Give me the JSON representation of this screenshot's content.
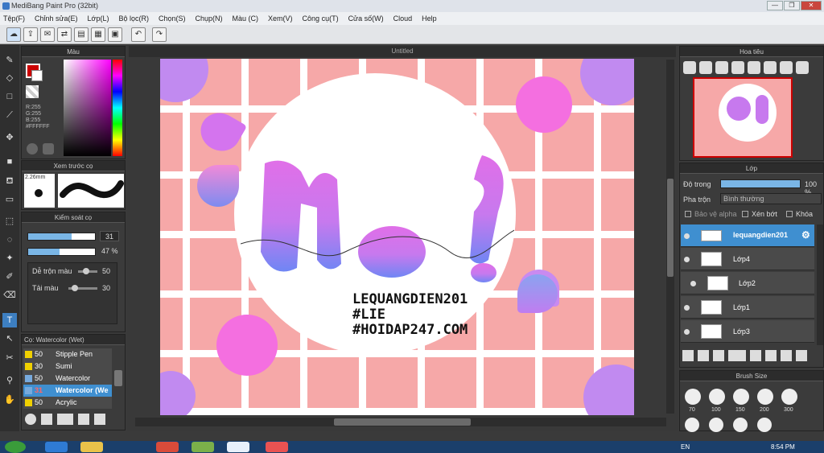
{
  "window": {
    "title": "MediBang Paint Pro (32bit)"
  },
  "menu": [
    "Tệp(F)",
    "Chỉnh sửa(E)",
    "Lớp(L)",
    "Bộ lọc(R)",
    "Chọn(S)",
    "Chụp(N)",
    "Màu (C)",
    "Xem(V)",
    "Công cụ(T)",
    "Cửa số(W)",
    "Cloud",
    "Help"
  ],
  "color_panel": {
    "title": "Màu",
    "r": "R:255",
    "g": "G:255",
    "b": "B:255",
    "hex": "#FFFFFF"
  },
  "brush_preview": {
    "title": "Xem trước cọ",
    "size": "2.26mm"
  },
  "brush_control": {
    "title": "Kiểm soát cọ",
    "size_value": "31",
    "opacity_value": "47 %",
    "size_level": 0.65,
    "opacity_level": 0.47,
    "mix_label": "Dễ trộn màu",
    "mix_value": "50",
    "amount_label": "Tải màu",
    "amount_value": "30"
  },
  "brush_list": {
    "title": "Cọ: Watercolor (Wet)",
    "items": [
      {
        "size": "50",
        "name": "Stipple Pen",
        "selected": false
      },
      {
        "size": "30",
        "name": "Sumi",
        "selected": false
      },
      {
        "size": "50",
        "name": "Watercolor",
        "selected": false
      },
      {
        "size": "31",
        "name": "Watercolor (We",
        "selected": true
      },
      {
        "size": "50",
        "name": "Acrylic",
        "selected": false
      }
    ]
  },
  "canvas": {
    "tab": "Untitled",
    "text1": "LEQUANGDIEN201",
    "text2": "#LIE",
    "text3": "#HOIDAP247.COM"
  },
  "navigator": {
    "title": "Hoa tiêu"
  },
  "layers": {
    "title": "Lớp",
    "opacity_label": "Độ trong",
    "opacity_value": "100 %",
    "opacity_level": 1.0,
    "blend_label": "Pha trộn",
    "blend_value": "Bình thường",
    "protect_alpha": "Bảo vệ alpha",
    "clipping": "Xén bớt",
    "lock": "Khóa",
    "items": [
      {
        "name": "lequangdien201",
        "selected": true
      },
      {
        "name": "Lớp4",
        "selected": false
      },
      {
        "name": "Lớp2",
        "selected": false
      },
      {
        "name": "Lớp1",
        "selected": false
      },
      {
        "name": "Lớp3",
        "selected": false
      }
    ]
  },
  "brush_size": {
    "title": "Brush Size",
    "sizes": [
      "70",
      "100",
      "150",
      "200",
      "300"
    ]
  },
  "taskbar": {
    "lang": "EN",
    "time": "8:54 PM"
  }
}
